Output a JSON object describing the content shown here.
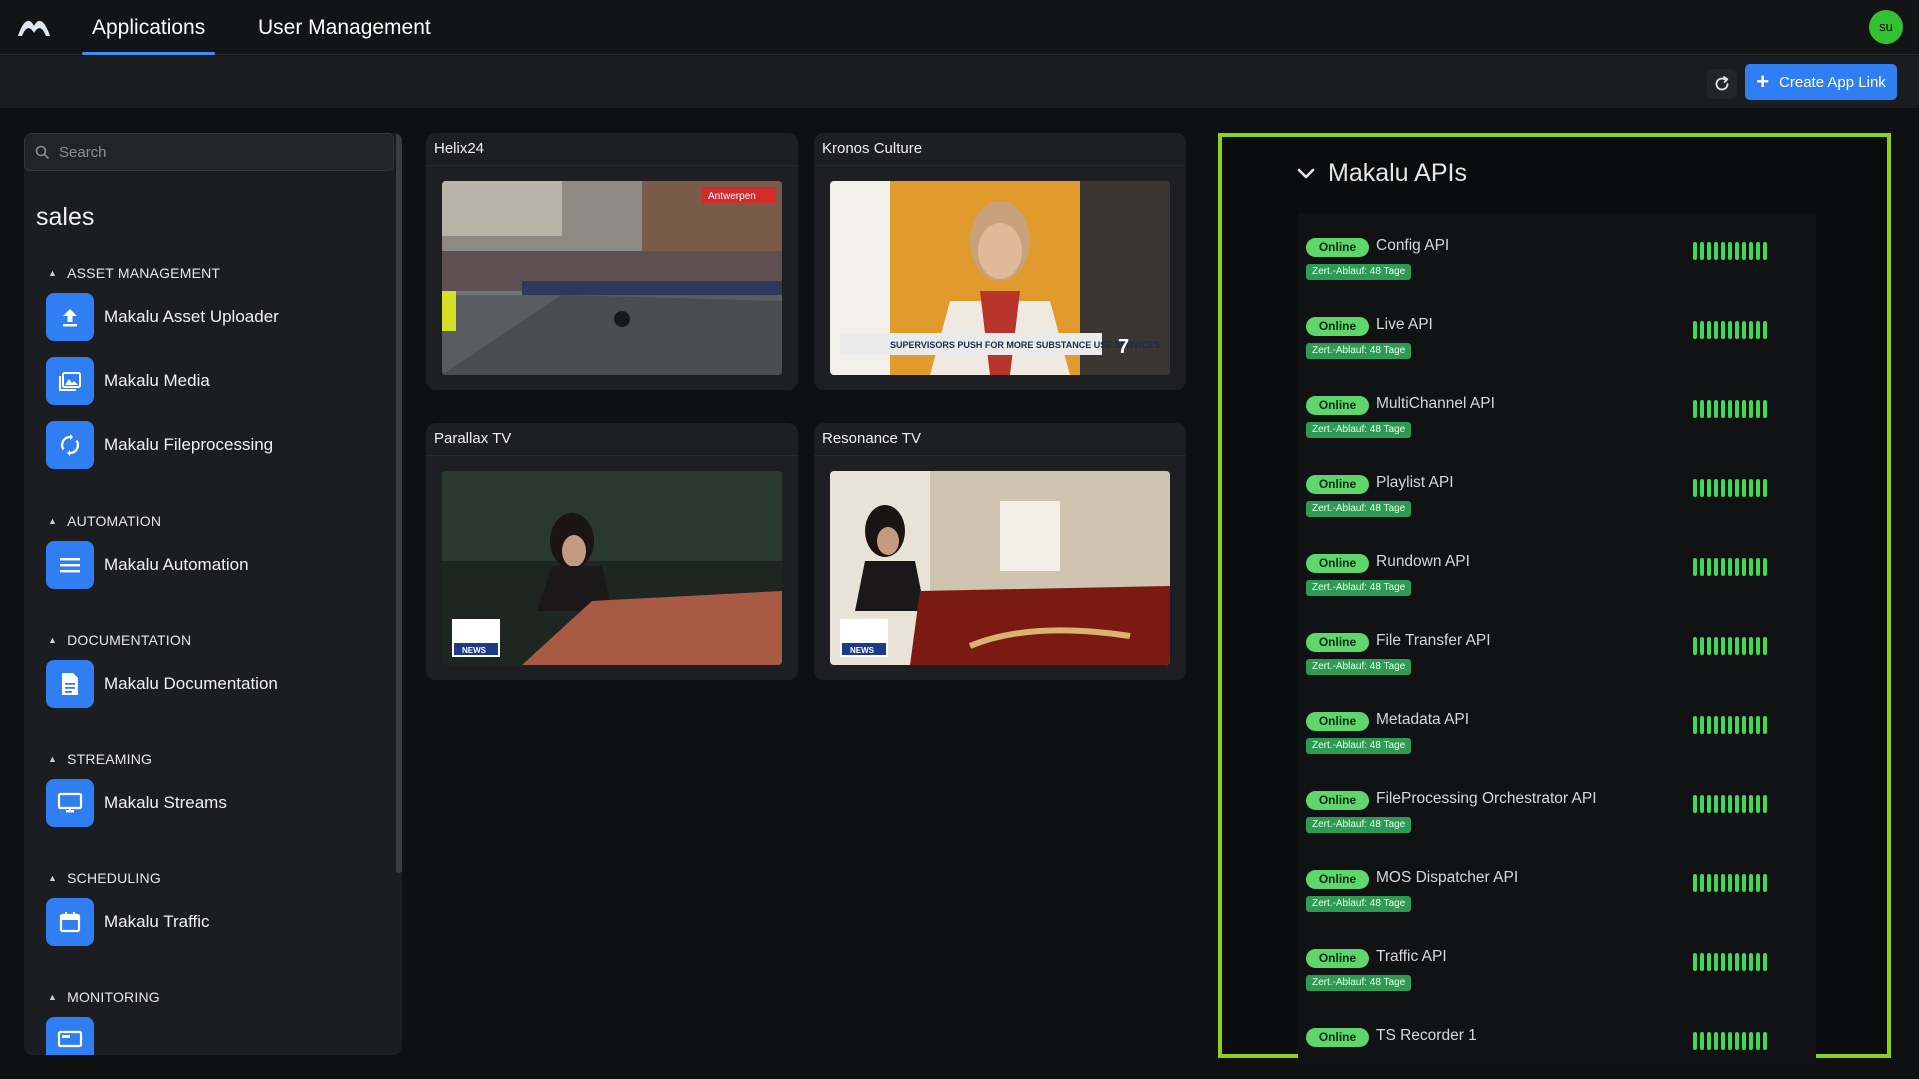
{
  "nav": {
    "tabs": [
      {
        "label": "Applications",
        "active": true
      },
      {
        "label": "User Management",
        "active": false
      }
    ],
    "avatar_initials": "su"
  },
  "toolbar": {
    "refresh_icon": "refresh-icon",
    "create_label": "Create App Link"
  },
  "sidebar": {
    "search_placeholder": "Search",
    "org": "sales",
    "groups": [
      {
        "title": "ASSET MANAGEMENT",
        "items": [
          {
            "label": "Makalu Asset Uploader",
            "icon": "upload-icon"
          },
          {
            "label": "Makalu Media",
            "icon": "image-gallery-icon"
          },
          {
            "label": "Makalu Fileprocessing",
            "icon": "sync-icon"
          }
        ]
      },
      {
        "title": "AUTOMATION",
        "items": [
          {
            "label": "Makalu Automation",
            "icon": "list-icon"
          }
        ]
      },
      {
        "title": "DOCUMENTATION",
        "items": [
          {
            "label": "Makalu Documentation",
            "icon": "document-icon"
          }
        ]
      },
      {
        "title": "STREAMING",
        "items": [
          {
            "label": "Makalu Streams",
            "icon": "monitor-icon"
          }
        ]
      },
      {
        "title": "SCHEDULING",
        "items": [
          {
            "label": "Makalu Traffic",
            "icon": "calendar-icon"
          }
        ]
      },
      {
        "title": "MONITORING",
        "items": [
          {
            "label": "",
            "icon": "monitor-icon"
          }
        ]
      }
    ]
  },
  "channels": [
    {
      "title": "Helix24",
      "overlay": "Antwerpen"
    },
    {
      "title": "Kronos Culture",
      "overlay": "SUPERVISORS PUSH FOR MORE SUBSTANCE USE SERVICES"
    },
    {
      "title": "Parallax TV",
      "overlay": "NEWS"
    },
    {
      "title": "Resonance TV",
      "overlay": "NEWS"
    }
  ],
  "api_panel": {
    "title": "Makalu APIs",
    "status_label": "Online",
    "cert_label": "Zert.-Ablauf: 48 Tage",
    "apis": [
      "Config API",
      "Live API",
      "MultiChannel API",
      "Playlist API",
      "Rundown API",
      "File Transfer API",
      "Metadata API",
      "FileProcessing Orchestrator API",
      "MOS Dispatcher API",
      "Traffic API",
      "TS Recorder 1"
    ],
    "accent_color": "#8fd11a",
    "online_color": "#5fd66b"
  }
}
